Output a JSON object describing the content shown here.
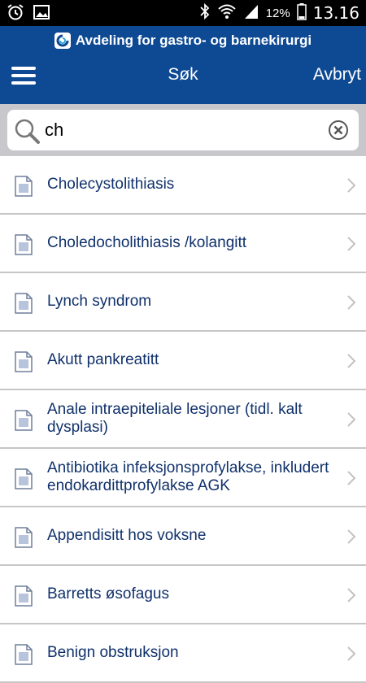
{
  "status": {
    "battery_percent": "12%",
    "time": "13.16"
  },
  "header": {
    "app_title": "Avdeling for gastro- og barnekirurgi",
    "nav_title": "Søk",
    "cancel_label": "Avbryt"
  },
  "search": {
    "value": "ch"
  },
  "results": [
    {
      "label": "Cholecystolithiasis"
    },
    {
      "label": "Choledocholithiasis /kolangitt"
    },
    {
      "label": "Lynch syndrom"
    },
    {
      "label": "Akutt pankreatitt"
    },
    {
      "label": "Anale intraepiteliale lesjoner (tidl. kalt dysplasi)"
    },
    {
      "label": "Antibiotika infeksjonsprofylakse, inkludert endokardittprofylakse AGK"
    },
    {
      "label": "Appendisitt hos voksne"
    },
    {
      "label": "Barretts øsofagus"
    },
    {
      "label": "Benign obstruksjon"
    }
  ],
  "colors": {
    "header_bg": "#0e4a94",
    "item_text": "#10316b",
    "search_bar_bg": "#c8c8cc"
  },
  "icons": [
    "alarm-icon",
    "gallery-icon",
    "bluetooth-icon",
    "wifi-icon",
    "signal-icon",
    "battery-icon",
    "menu-icon",
    "search-icon",
    "clear-icon",
    "document-icon",
    "chevron-right-icon"
  ]
}
